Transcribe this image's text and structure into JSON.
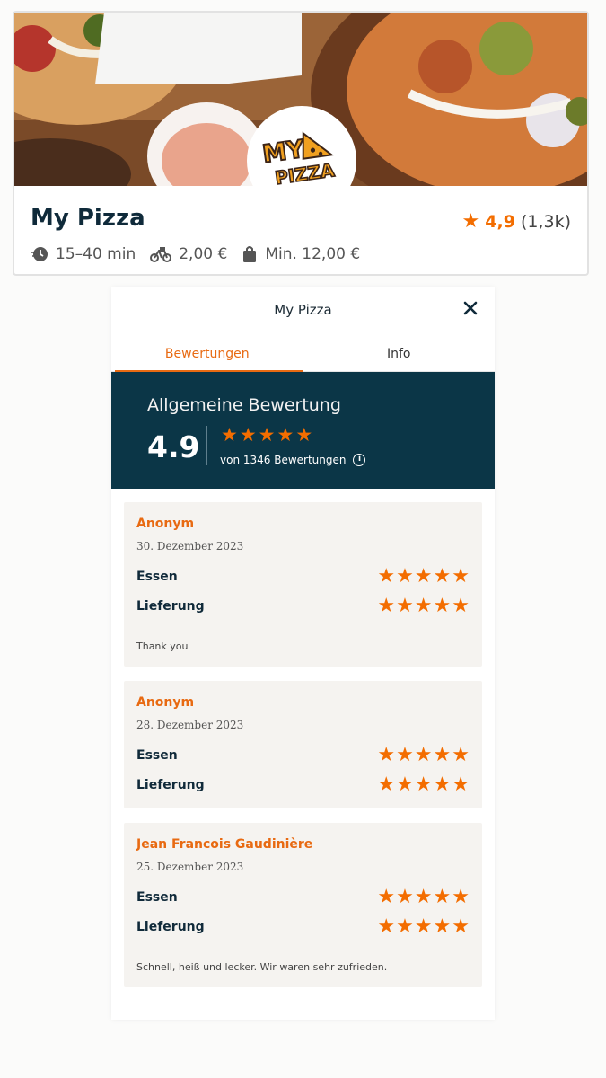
{
  "restaurant": {
    "name": "My Pizza",
    "rating": "4,9",
    "rating_count": "(1,3k)",
    "delivery_time": "15–40 min",
    "delivery_fee": "2,00 €",
    "min_order": "Min. 12,00 €",
    "logo_line1": "MY",
    "logo_line2": "PIZZA"
  },
  "modal": {
    "title": "My Pizza",
    "tabs": [
      {
        "label": "Bewertungen",
        "active": true
      },
      {
        "label": "Info",
        "active": false
      }
    ],
    "summary": {
      "title": "Allgemeine Bewertung",
      "score": "4.9",
      "stars": 5,
      "count_text": "von 1346 Bewertungen"
    },
    "reviews": [
      {
        "name": "Anonym",
        "date": "30. Dezember 2023",
        "food_label": "Essen",
        "food_stars": 5,
        "delivery_label": "Lieferung",
        "delivery_stars": 5,
        "comment": "Thank you"
      },
      {
        "name": "Anonym",
        "date": "28. Dezember 2023",
        "food_label": "Essen",
        "food_stars": 5,
        "delivery_label": "Lieferung",
        "delivery_stars": 5,
        "comment": ""
      },
      {
        "name": "Jean Francois Gaudinière",
        "date": "25. Dezember 2023",
        "food_label": "Essen",
        "food_stars": 5,
        "delivery_label": "Lieferung",
        "delivery_stars": 5,
        "comment": "Schnell, heiß und lecker. Wir waren sehr zufrieden."
      }
    ]
  },
  "colors": {
    "accent": "#f36d00",
    "header_bg": "#0b3647",
    "review_bg": "#f5f3f0"
  },
  "icons": {
    "rating": "star-icon",
    "time": "clock-icon",
    "fee": "bike-icon",
    "min_order": "bag-icon",
    "close": "close-icon",
    "info": "info-icon"
  }
}
